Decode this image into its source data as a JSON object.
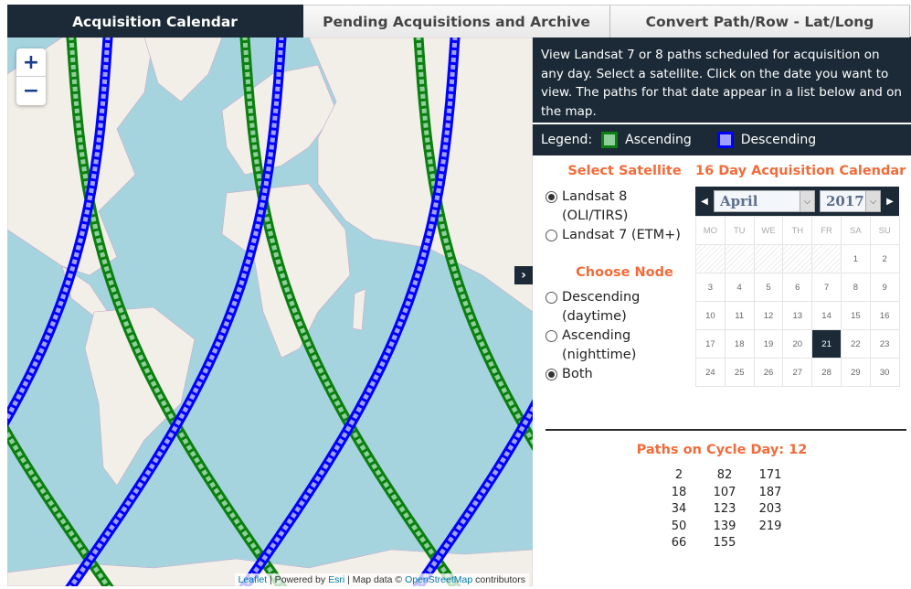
{
  "tabs": [
    {
      "label": "Acquisition Calendar",
      "active": true
    },
    {
      "label": "Pending Acquisitions and Archive",
      "active": false
    },
    {
      "label": "Convert Path/Row - Lat/Long",
      "active": false
    }
  ],
  "map": {
    "zoom_in": "+",
    "zoom_out": "−",
    "collapse_icon": "›",
    "attribution": {
      "leaflet": "Leaflet",
      "sep1": " | Powered by ",
      "esri": "Esri",
      "sep2": " | Map data © ",
      "osm": "OpenStreetMap",
      "tail": " contributors"
    },
    "colors": {
      "ascending": "#0b8010",
      "descending": "#0000ff",
      "water": "#a6d4de",
      "land": "#f2efe9"
    }
  },
  "intro": "View Landsat 7 or 8 paths scheduled for acquisition on any day. Select a satellite. Click on the date you want to view. The paths for that date appear in a list below and on the map.",
  "legend": {
    "label": "Legend:",
    "ascending": "Ascending",
    "descending": "Descending"
  },
  "satellite": {
    "title": "Select Satellite",
    "options": [
      {
        "label": "Landsat 8 (OLI/TIRS)",
        "checked": true
      },
      {
        "label": "Landsat 7 (ETM+)",
        "checked": false
      }
    ]
  },
  "node": {
    "title": "Choose Node",
    "options": [
      {
        "label": "Descending (daytime)",
        "checked": false
      },
      {
        "label": "Ascending (nighttime)",
        "checked": false
      },
      {
        "label": "Both",
        "checked": true
      }
    ]
  },
  "calendar": {
    "title": "16 Day Acquisition Calendar",
    "month": "April",
    "year": "2017",
    "weekdays": [
      "MO",
      "TU",
      "WE",
      "TH",
      "FR",
      "SA",
      "SU"
    ],
    "leading_blanks": 5,
    "days_in_month": 30,
    "selected_day": 21
  },
  "paths": {
    "title": "Paths on Cycle Day: 12",
    "columns": [
      [
        "2",
        "18",
        "34",
        "50",
        "66"
      ],
      [
        "82",
        "107",
        "123",
        "139",
        "155"
      ],
      [
        "171",
        "187",
        "203",
        "219"
      ]
    ]
  }
}
